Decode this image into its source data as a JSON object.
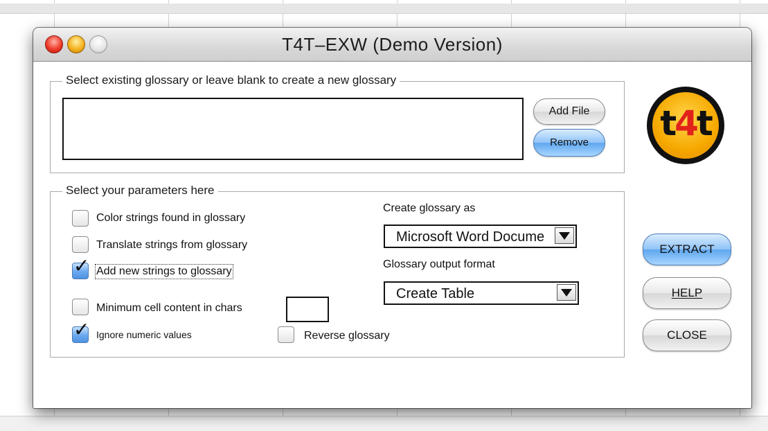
{
  "window": {
    "title": "T4T–EXW  (Demo Version)"
  },
  "glossary_group": {
    "label": "Select existing glossary or leave blank to create a new glossary",
    "add_file_label": "Add File",
    "remove_label": "Remove"
  },
  "logo": {
    "prefix": "t",
    "number": "4",
    "suffix": "t"
  },
  "params_group": {
    "label": "Select your parameters here",
    "color_strings": {
      "label": "Color strings found in glossary",
      "checked": false
    },
    "translate_strings": {
      "label": "Translate strings from glossary",
      "checked": false
    },
    "add_new_strings": {
      "label": "Add new strings to glossary",
      "checked": true
    },
    "minimum_cell": {
      "label": "Minimum cell content in chars",
      "checked": false,
      "value": ""
    },
    "ignore_numeric": {
      "label": "Ignore numeric values",
      "checked": true
    },
    "reverse_glossary": {
      "label": "Reverse glossary",
      "checked": false
    },
    "create_as_label": "Create glossary as",
    "create_as_value": "Microsoft Word Docume",
    "output_format_label": "Glossary output format",
    "output_format_value": "Create Table"
  },
  "buttons": {
    "extract": "EXTRACT",
    "help": "HELP",
    "close": "CLOSE"
  },
  "colors": {
    "accent_blue": "#6aa8ee",
    "logo_yellow": "#f6a800",
    "logo_red": "#e2231a"
  }
}
